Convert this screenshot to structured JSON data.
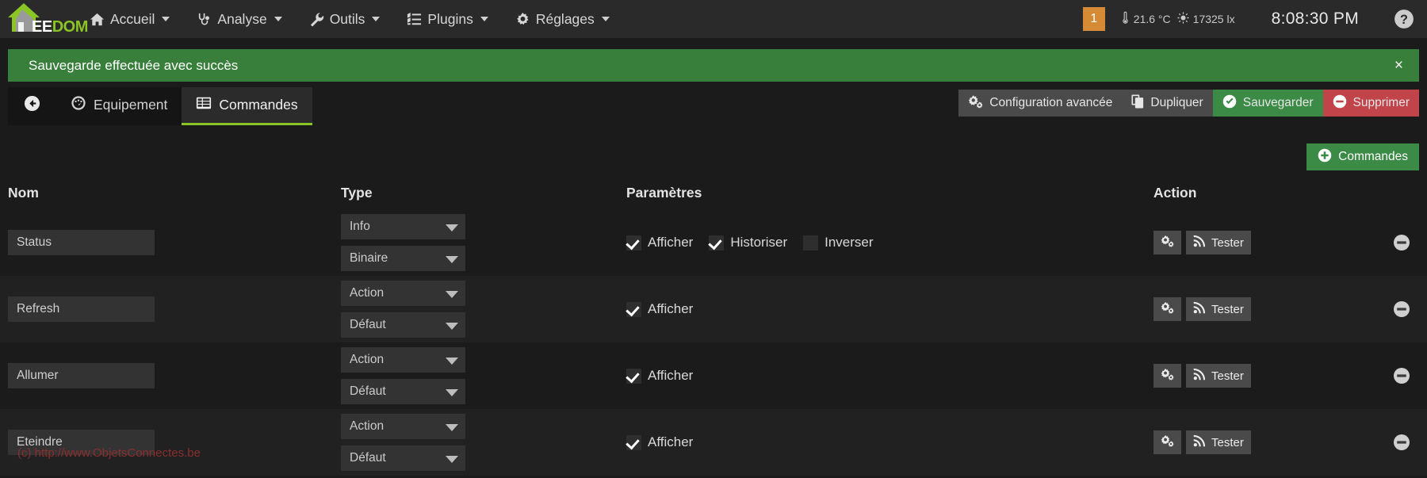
{
  "header": {
    "brand": {
      "ee": "EE",
      "dom": "DOM"
    },
    "nav": [
      {
        "label": "Accueil",
        "icon": "home-icon",
        "caret": true
      },
      {
        "label": "Analyse",
        "icon": "stethoscope-icon",
        "caret": true
      },
      {
        "label": "Outils",
        "icon": "wrench-icon",
        "caret": true
      },
      {
        "label": "Plugins",
        "icon": "list-icon",
        "caret": true
      },
      {
        "label": "Réglages",
        "icon": "gear-icon",
        "caret": true
      }
    ],
    "badge_count": "1",
    "sensors": [
      {
        "icon": "thermometer-icon",
        "value": "21.6 °C"
      },
      {
        "icon": "sun-icon",
        "value": "17325 lx"
      }
    ],
    "clock": "8:08:30 PM",
    "help_icon": "question-circle-icon",
    "badge_color": "#d58b36"
  },
  "alert": {
    "message": "Sauvegarde effectuée avec succès",
    "close_label": "×",
    "color": "#387f3c"
  },
  "tabbar": {
    "back_icon": "arrow-circle-left-icon",
    "tabs": [
      {
        "label": "Equipement",
        "icon": "dashboard-icon",
        "active": false
      },
      {
        "label": "Commandes",
        "icon": "table-icon",
        "active": true
      }
    ],
    "actions": [
      {
        "label": "Configuration avancée",
        "icon": "gears-icon",
        "style": "grey"
      },
      {
        "label": "Dupliquer",
        "icon": "copy-icon",
        "style": "grey"
      },
      {
        "label": "Sauvegarder",
        "icon": "check-circle-icon",
        "style": "green"
      },
      {
        "label": "Supprimer",
        "icon": "minus-circle-icon",
        "style": "red"
      }
    ]
  },
  "toolbar": {
    "add_command_label": "Commandes",
    "add_command_icon": "plus-circle-icon"
  },
  "table": {
    "columns": [
      "Nom",
      "Type",
      "Paramètres",
      "Action"
    ],
    "rows": [
      {
        "name": "Status",
        "type": "Info",
        "subtype": "Binaire",
        "params": [
          {
            "label": "Afficher",
            "checked": true
          },
          {
            "label": "Historiser",
            "checked": true
          },
          {
            "label": "Inverser",
            "checked": false
          }
        ],
        "config_icon": "gears-icon",
        "test_label": "Tester",
        "test_icon": "signal-icon",
        "remove_icon": "minus-circle-icon"
      },
      {
        "name": "Refresh",
        "type": "Action",
        "subtype": "Défaut",
        "params": [
          {
            "label": "Afficher",
            "checked": true
          }
        ],
        "config_icon": "gears-icon",
        "test_label": "Tester",
        "test_icon": "signal-icon",
        "remove_icon": "minus-circle-icon"
      },
      {
        "name": "Allumer",
        "type": "Action",
        "subtype": "Défaut",
        "params": [
          {
            "label": "Afficher",
            "checked": true
          }
        ],
        "config_icon": "gears-icon",
        "test_label": "Tester",
        "test_icon": "signal-icon",
        "remove_icon": "minus-circle-icon"
      },
      {
        "name": "Eteindre",
        "type": "Action",
        "subtype": "Défaut",
        "params": [
          {
            "label": "Afficher",
            "checked": true
          }
        ],
        "config_icon": "gears-icon",
        "test_label": "Tester",
        "test_icon": "signal-icon",
        "remove_icon": "minus-circle-icon"
      }
    ]
  },
  "watermark": "(c) http://www.ObjetsConnectes.be"
}
